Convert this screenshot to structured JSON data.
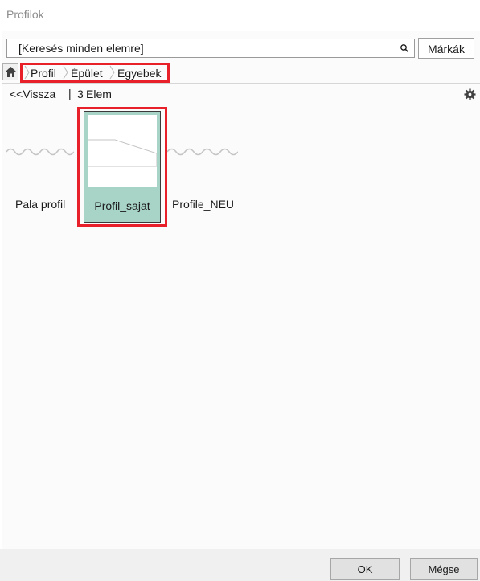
{
  "window": {
    "title": "Profilok"
  },
  "search": {
    "placeholder": "[Keresés minden elemre]",
    "value": ""
  },
  "toolbar": {
    "brands_label": "Márkák"
  },
  "breadcrumb": {
    "items": [
      {
        "label": "Profil"
      },
      {
        "label": "Épület"
      },
      {
        "label": "Egyebek"
      }
    ]
  },
  "nav": {
    "back_label": "<<Vissza",
    "separator": "|",
    "count": "3",
    "count_label": "Elem"
  },
  "items": [
    {
      "label": "Pala profil",
      "selected": false,
      "icon": "wave-profile-icon"
    },
    {
      "label": "Profil_sajat",
      "selected": true,
      "icon": "custom-profile-icon"
    },
    {
      "label": "Profile_NEU",
      "selected": false,
      "icon": "wave-profile-icon"
    }
  ],
  "footer": {
    "ok_label": "OK",
    "cancel_label": "Mégse"
  },
  "colors": {
    "highlight": "#e8202a",
    "selection": "#a8d4c8"
  }
}
